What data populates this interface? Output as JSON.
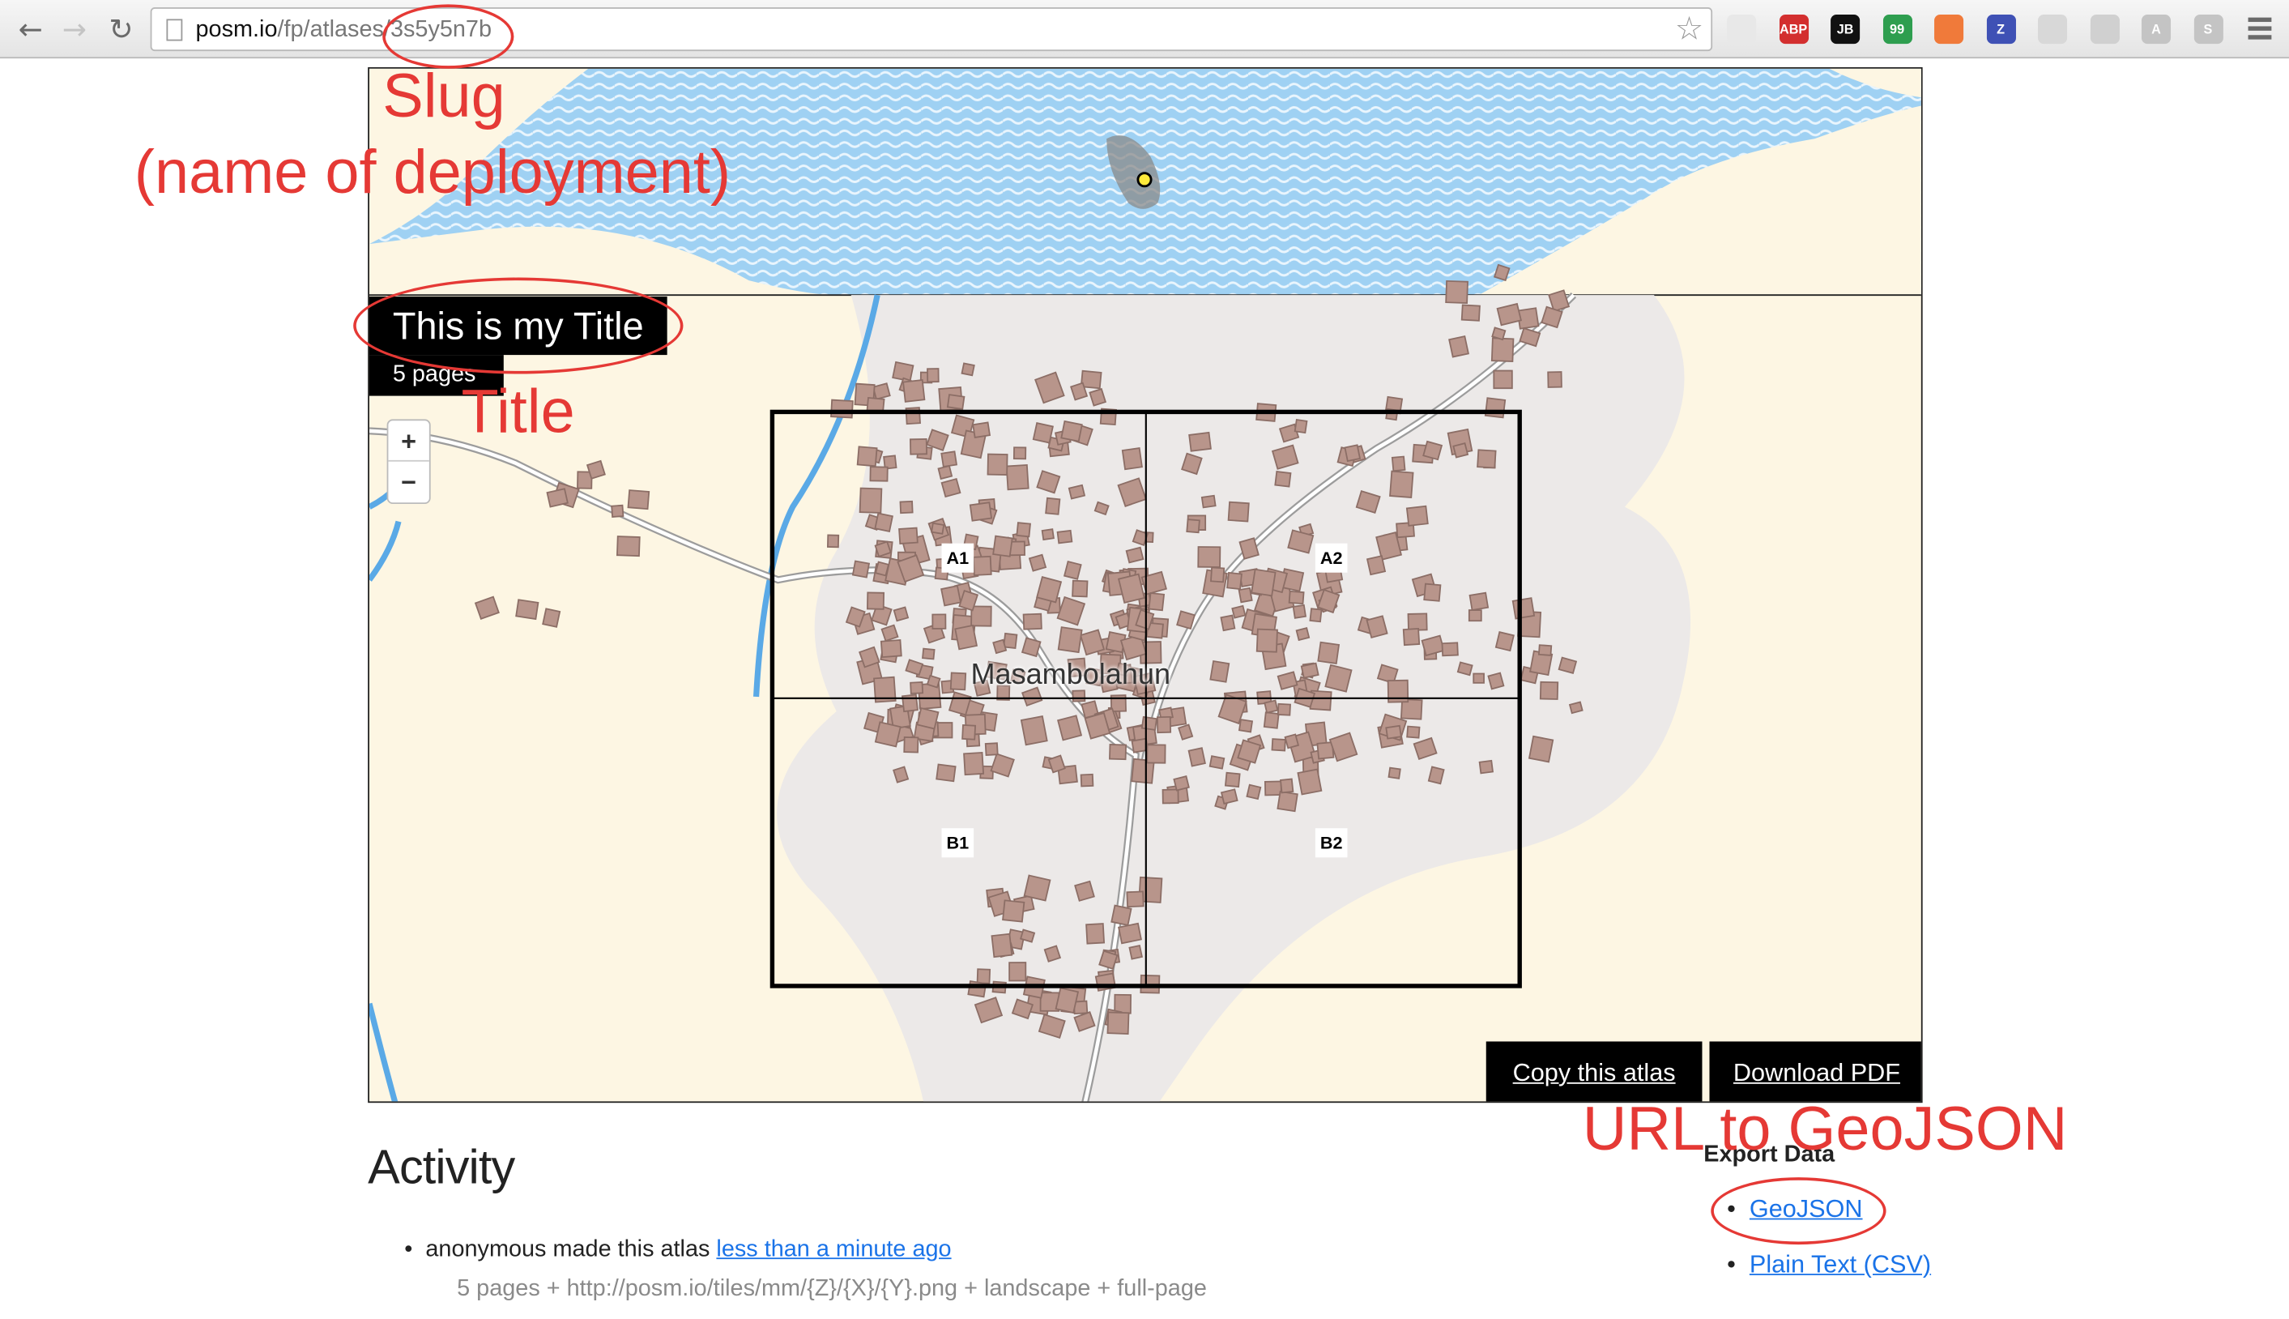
{
  "browser": {
    "url_host": "posm.io",
    "url_path": "/fp/atlases/3s5y5n7b",
    "extensions": [
      {
        "name": "color-wheel-icon",
        "label": "",
        "color": "#e8e8e8"
      },
      {
        "name": "adblock-plus-icon",
        "label": "ABP",
        "color": "#d32f2f"
      },
      {
        "name": "jetbrains-icon",
        "label": "JB",
        "color": "#111111"
      },
      {
        "name": "hangouts-icon",
        "label": "99",
        "color": "#2e9e4f"
      },
      {
        "name": "lifebuoy-icon",
        "label": "",
        "color": "#f07a3a"
      },
      {
        "name": "zotero-icon",
        "label": "Z",
        "color": "#3f51b5"
      },
      {
        "name": "swirl-icon",
        "label": "",
        "color": "#d8d8d8"
      },
      {
        "name": "dot-icon",
        "label": "",
        "color": "#d0d0d0"
      },
      {
        "name": "angular-icon",
        "label": "A",
        "color": "#c4c4c4"
      },
      {
        "name": "s-icon",
        "label": "S",
        "color": "#c4c4c4"
      }
    ]
  },
  "map": {
    "title": "This is my Title",
    "page_count": "5 pages",
    "zoom_in": "+",
    "zoom_out": "−",
    "place_label": "Masambolahun",
    "grid_cells": [
      "A1",
      "A2",
      "B1",
      "B2"
    ],
    "copy_button": "Copy this atlas",
    "download_button": "Download PDF"
  },
  "activity": {
    "heading": "Activity",
    "item_prefix": "anonymous made this atlas ",
    "item_link": "less than a minute ago",
    "detail": "5 pages + http://posm.io/tiles/mm/{Z}/{X}/{Y}.png + landscape + full-page"
  },
  "export": {
    "heading": "Export Data",
    "links": [
      "GeoJSON",
      "Plain Text (CSV)"
    ]
  },
  "annotations": {
    "slug": "Slug",
    "slug_sub": "(name of deployment)",
    "title": "Title",
    "geojson": "URL to GeoJSON",
    "color": "#e53935"
  }
}
